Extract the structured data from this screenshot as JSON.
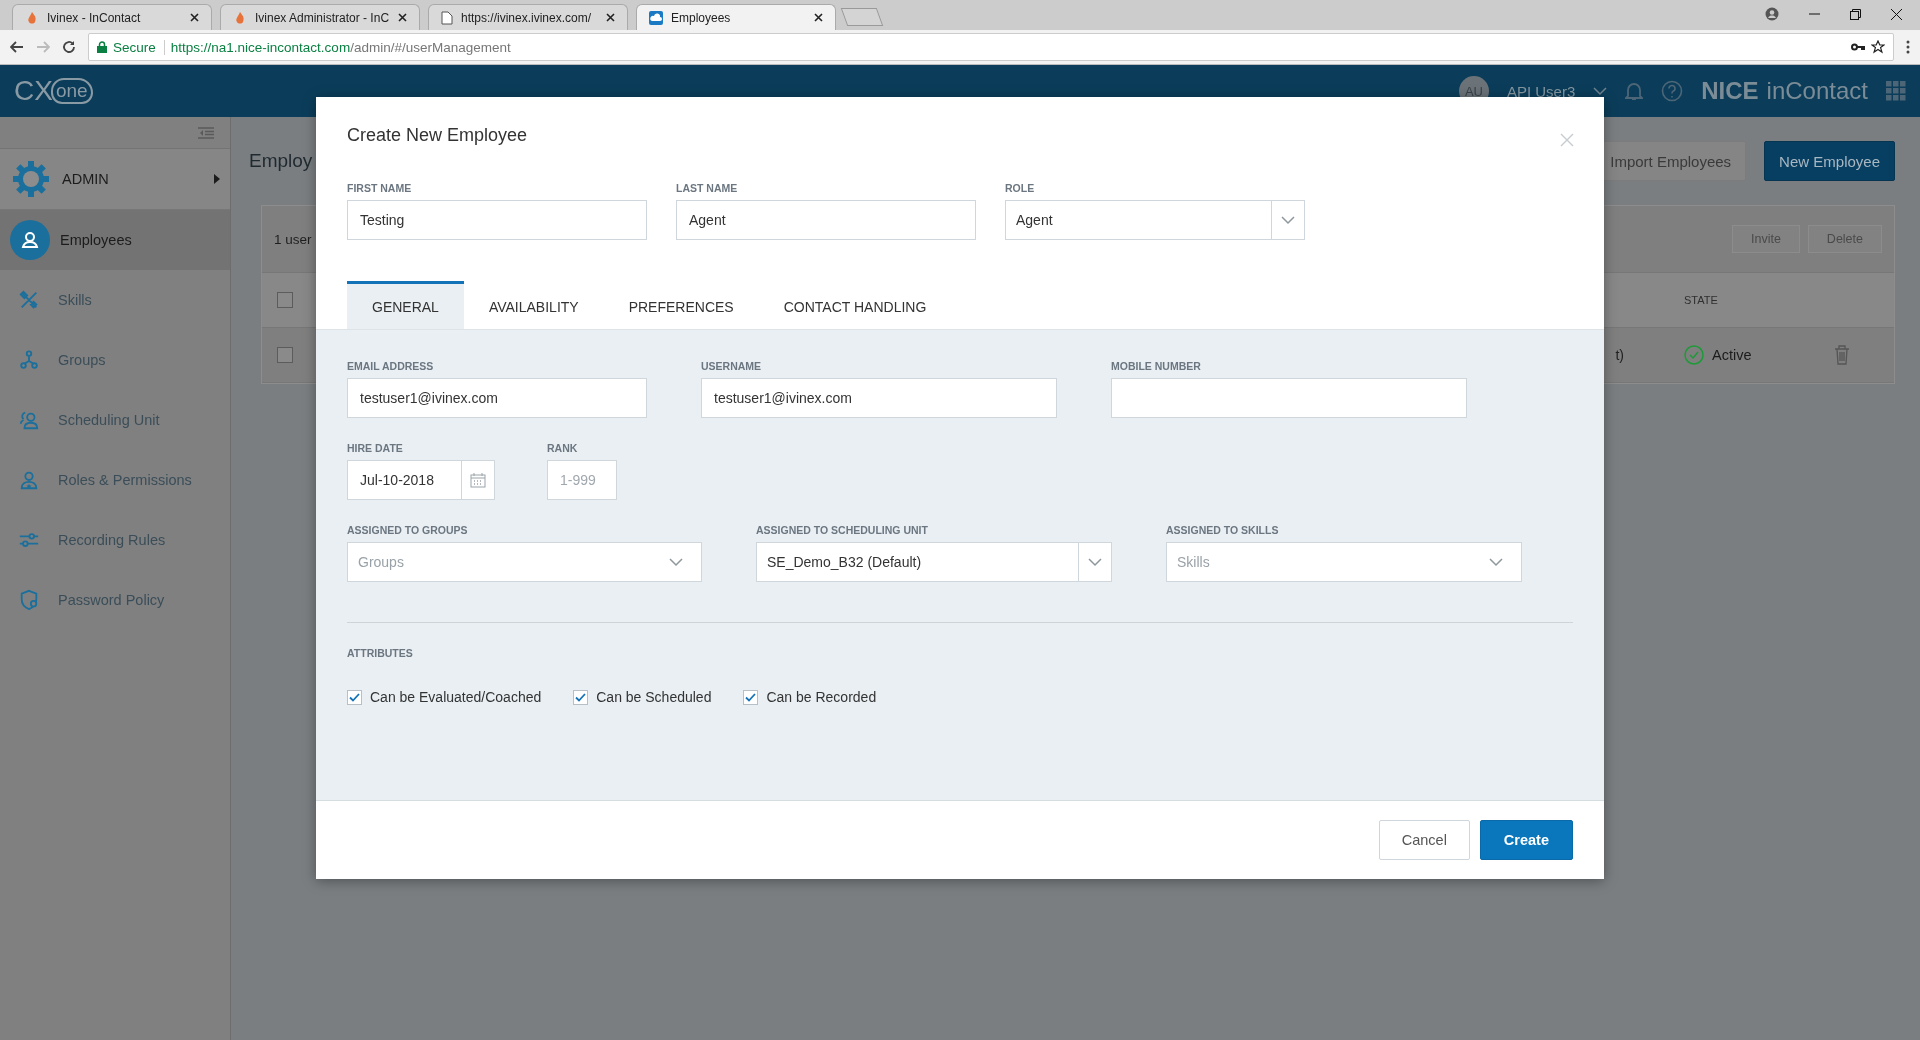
{
  "browser": {
    "tabs": [
      {
        "title": "Ivinex - InContact",
        "selected": false
      },
      {
        "title": "Ivinex Administrator - InC",
        "selected": false
      },
      {
        "title": "https://ivinex.ivinex.com/",
        "selected": false
      },
      {
        "title": "Employees",
        "selected": true
      }
    ],
    "address": {
      "secure": "Secure",
      "host": "https://na1.nice-incontact.com",
      "path": "/admin/#/userManagement"
    }
  },
  "header": {
    "logo_main": "CX",
    "logo_sub": "one",
    "avatar": "AU",
    "user": "API User3",
    "brand_main": "NICE",
    "brand_sub": "inContact"
  },
  "sidebar": {
    "section": "ADMIN",
    "items": [
      {
        "label": "Employees",
        "selected": true
      },
      {
        "label": "Skills",
        "selected": false
      },
      {
        "label": "Groups",
        "selected": false
      },
      {
        "label": "Scheduling Unit",
        "selected": false
      },
      {
        "label": "Roles & Permissions",
        "selected": false
      },
      {
        "label": "Recording Rules",
        "selected": false
      },
      {
        "label": "Password Policy",
        "selected": false
      }
    ]
  },
  "page": {
    "title": "Employ",
    "actions": [
      {
        "label": "Import Employees",
        "kind": "secondary"
      },
      {
        "label": "New Employee",
        "kind": "primary"
      }
    ],
    "table": {
      "count": "1 user",
      "buttons": [
        {
          "label": "Invite",
          "disabled": true
        },
        {
          "label": "Delete",
          "disabled": true
        }
      ],
      "select_all": {
        "checked": false
      },
      "state_header": "STATE",
      "rows": [
        {
          "checked": false,
          "column_3": "t)",
          "state": "Active"
        }
      ]
    }
  },
  "dialog": {
    "title": "Create New Employee",
    "top_fields": [
      {
        "kind": "text",
        "label": "FIRST NAME",
        "value": "Testing"
      },
      {
        "kind": "text",
        "label": "LAST NAME",
        "value": "Agent"
      },
      {
        "kind": "select",
        "label": "ROLE",
        "value": "Agent"
      }
    ],
    "tabs": [
      {
        "label": "GENERAL",
        "selected": true
      },
      {
        "label": "AVAILABILITY",
        "selected": false
      },
      {
        "label": "PREFERENCES",
        "selected": false
      },
      {
        "label": "CONTACT HANDLING",
        "selected": false
      }
    ],
    "general_rows": [
      [
        {
          "kind": "text",
          "label": "EMAIL ADDRESS",
          "value": "testuser1@ivinex.com"
        },
        {
          "kind": "text",
          "label": "USERNAME",
          "value": "testuser1@ivinex.com"
        },
        {
          "kind": "text",
          "label": "MOBILE NUMBER"
        }
      ],
      [
        {
          "kind": "date",
          "label": "HIRE DATE",
          "value": "Jul-10-2018"
        },
        {
          "kind": "text",
          "label": "RANK",
          "placeholder": "1-999"
        }
      ],
      [
        {
          "kind": "multiselect",
          "label": "ASSIGNED TO GROUPS",
          "placeholder": "Groups"
        },
        {
          "kind": "select",
          "label": "ASSIGNED TO SCHEDULING UNIT",
          "value": "SE_Demo_B32 (Default)"
        },
        {
          "kind": "multiselect",
          "label": "ASSIGNED TO SKILLS",
          "placeholder": "Skills"
        }
      ]
    ],
    "attributes": {
      "label": "ATTRIBUTES",
      "items": [
        {
          "label": "Can be Evaluated/Coached",
          "checked": true
        },
        {
          "label": "Can be Scheduled",
          "checked": true
        },
        {
          "label": "Can be Recorded",
          "checked": true
        }
      ]
    },
    "buttons": [
      {
        "label": "Cancel",
        "kind": "secondary"
      },
      {
        "label": "Create",
        "kind": "primary"
      }
    ]
  }
}
